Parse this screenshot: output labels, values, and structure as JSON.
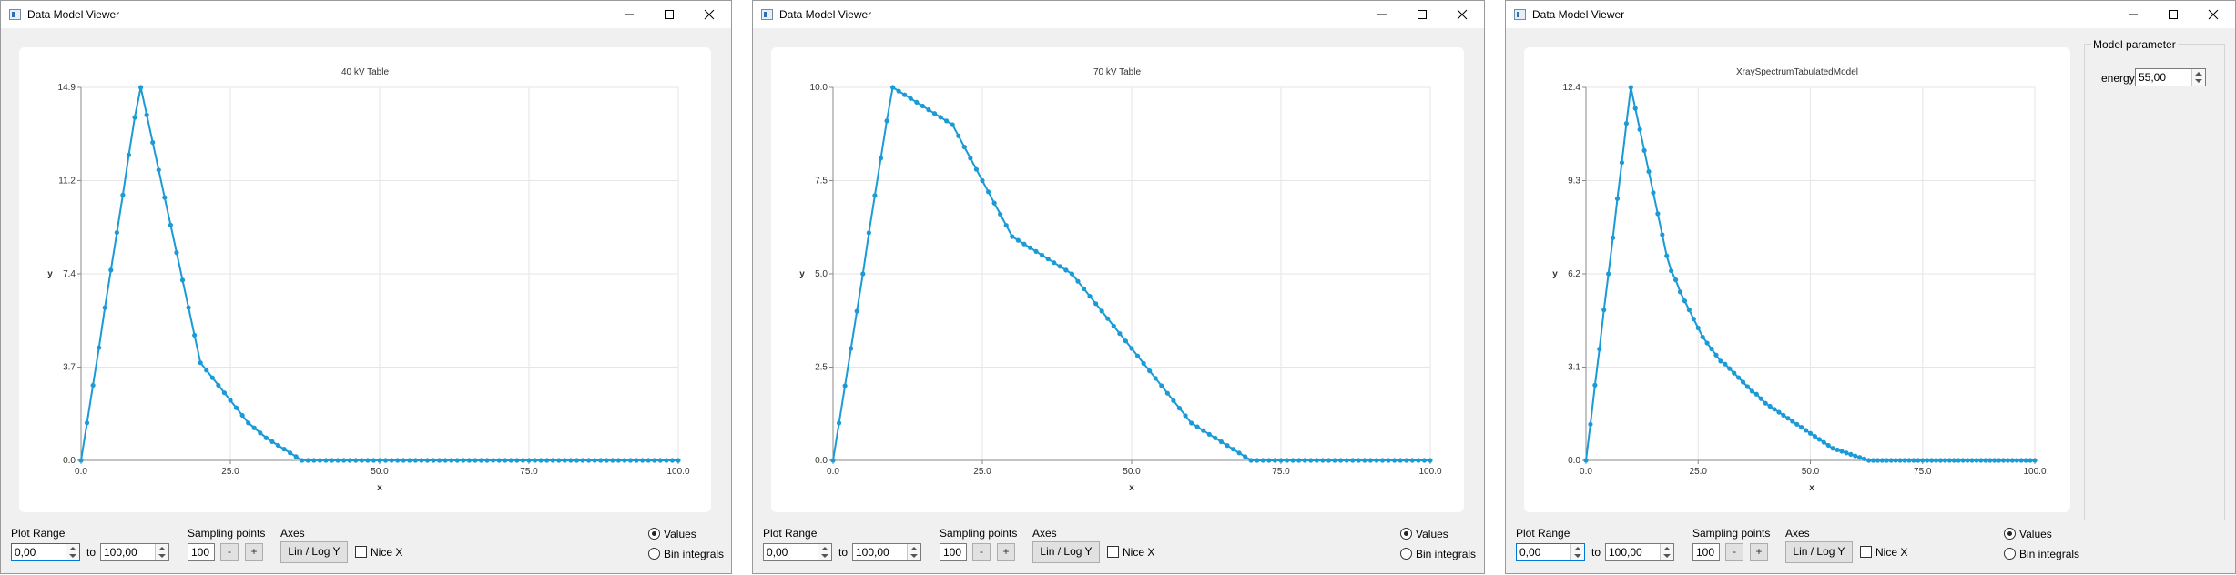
{
  "windows": [
    {
      "title": "Data Model Viewer",
      "chart": {
        "title": "40 kV Table",
        "xlabel": "x",
        "ylabel": "y",
        "yticks": [
          "0.0",
          "3.7",
          "7.4",
          "11.2",
          "14.9"
        ],
        "xticks": [
          "0.0",
          "25.0",
          "50.0",
          "75.0",
          "100.0"
        ]
      },
      "controls": {
        "plot_range_label": "Plot Range",
        "range_from": "0,00",
        "to_label": "to",
        "range_to": "100,00",
        "sampling_label": "Sampling points",
        "sampling_value": "100",
        "minus_label": "-",
        "plus_label": "+",
        "axes_label": "Axes",
        "linlog_label": "Lin / Log Y",
        "nicex_label": "Nice X",
        "values_label": "Values",
        "bin_label": "Bin integrals"
      }
    },
    {
      "title": "Data Model Viewer",
      "chart": {
        "title": "70 kV Table",
        "xlabel": "x",
        "ylabel": "y",
        "yticks": [
          "0.0",
          "2.5",
          "5.0",
          "7.5",
          "10.0"
        ],
        "xticks": [
          "0.0",
          "25.0",
          "50.0",
          "75.0",
          "100.0"
        ]
      },
      "controls": {
        "plot_range_label": "Plot Range",
        "range_from": "0,00",
        "to_label": "to",
        "range_to": "100,00",
        "sampling_label": "Sampling points",
        "sampling_value": "100",
        "minus_label": "-",
        "plus_label": "+",
        "axes_label": "Axes",
        "linlog_label": "Lin / Log Y",
        "nicex_label": "Nice X",
        "values_label": "Values",
        "bin_label": "Bin integrals"
      }
    },
    {
      "title": "Data Model Viewer",
      "chart": {
        "title": "XraySpectrumTabulatedModel",
        "xlabel": "x",
        "ylabel": "y",
        "yticks": [
          "0.0",
          "3.1",
          "6.2",
          "9.3",
          "12.4"
        ],
        "xticks": [
          "0.0",
          "25.0",
          "50.0",
          "75.0",
          "100.0"
        ]
      },
      "controls": {
        "plot_range_label": "Plot Range",
        "range_from": "0,00",
        "to_label": "to",
        "range_to": "100,00",
        "sampling_label": "Sampling points",
        "sampling_value": "100",
        "minus_label": "-",
        "plus_label": "+",
        "axes_label": "Axes",
        "linlog_label": "Lin / Log Y",
        "nicex_label": "Nice X",
        "values_label": "Values",
        "bin_label": "Bin integrals"
      },
      "model_parameter": {
        "group_title": "Model parameter",
        "energy_label": "energy",
        "energy_value": "55,00"
      }
    }
  ],
  "style": {
    "line_color": "#1a9ad6",
    "grid_color": "#e6e6e6"
  },
  "chart_data": [
    {
      "type": "line",
      "title": "40 kV Table",
      "xlabel": "x",
      "ylabel": "y",
      "xlim": [
        0,
        100
      ],
      "ylim": [
        0,
        14.9
      ],
      "series": [
        {
          "x": [
            0,
            1,
            2,
            3,
            4,
            5,
            6,
            7,
            8,
            9,
            10,
            11,
            12,
            13,
            14,
            15,
            16,
            17,
            18,
            19,
            20,
            21,
            22,
            23,
            24,
            25,
            26,
            27,
            28,
            29,
            30,
            31,
            32,
            33,
            34,
            35,
            36,
            37,
            38,
            39,
            40,
            41,
            42,
            43,
            44,
            45,
            46,
            47,
            48,
            49,
            50,
            51,
            52,
            53,
            54,
            55,
            56,
            57,
            58,
            59,
            60,
            61,
            62,
            63,
            64,
            65,
            66,
            67,
            68,
            69,
            70,
            71,
            72,
            73,
            74,
            75,
            76,
            77,
            78,
            79,
            80,
            81,
            82,
            83,
            84,
            85,
            86,
            87,
            88,
            89,
            90,
            91,
            92,
            93,
            94,
            95,
            96,
            97,
            98,
            99,
            100
          ],
          "y": [
            0.0,
            1.5,
            3.0,
            4.5,
            6.1,
            7.6,
            9.1,
            10.6,
            12.2,
            13.7,
            14.9,
            13.8,
            12.7,
            11.6,
            10.5,
            9.4,
            8.3,
            7.2,
            6.1,
            5.0,
            3.9,
            3.6,
            3.3,
            3.0,
            2.7,
            2.4,
            2.1,
            1.8,
            1.5,
            1.3,
            1.1,
            0.9,
            0.75,
            0.6,
            0.45,
            0.3,
            0.15,
            0.0,
            0.0,
            0.0,
            0.0,
            0.0,
            0.0,
            0.0,
            0.0,
            0.0,
            0.0,
            0.0,
            0.0,
            0.0,
            0.0,
            0.0,
            0.0,
            0.0,
            0.0,
            0.0,
            0.0,
            0.0,
            0.0,
            0.0,
            0.0,
            0.0,
            0.0,
            0.0,
            0.0,
            0.0,
            0.0,
            0.0,
            0.0,
            0.0,
            0.0,
            0.0,
            0.0,
            0.0,
            0.0,
            0.0,
            0.0,
            0.0,
            0.0,
            0.0,
            0.0,
            0.0,
            0.0,
            0.0,
            0.0,
            0.0,
            0.0,
            0.0,
            0.0,
            0.0,
            0.0,
            0.0,
            0.0,
            0.0,
            0.0,
            0.0,
            0.0,
            0.0,
            0.0,
            0.0,
            0.0
          ]
        }
      ]
    },
    {
      "type": "line",
      "title": "70 kV Table",
      "xlabel": "x",
      "ylabel": "y",
      "xlim": [
        0,
        100
      ],
      "ylim": [
        0,
        10.0
      ],
      "series": [
        {
          "x": [
            0,
            1,
            2,
            3,
            4,
            5,
            6,
            7,
            8,
            9,
            10,
            11,
            12,
            13,
            14,
            15,
            16,
            17,
            18,
            19,
            20,
            21,
            22,
            23,
            24,
            25,
            26,
            27,
            28,
            29,
            30,
            31,
            32,
            33,
            34,
            35,
            36,
            37,
            38,
            39,
            40,
            41,
            42,
            43,
            44,
            45,
            46,
            47,
            48,
            49,
            50,
            51,
            52,
            53,
            54,
            55,
            56,
            57,
            58,
            59,
            60,
            61,
            62,
            63,
            64,
            65,
            66,
            67,
            68,
            69,
            70,
            71,
            72,
            73,
            74,
            75,
            76,
            77,
            78,
            79,
            80,
            81,
            82,
            83,
            84,
            85,
            86,
            87,
            88,
            89,
            90,
            91,
            92,
            93,
            94,
            95,
            96,
            97,
            98,
            99,
            100
          ],
          "y": [
            0.0,
            1.0,
            2.0,
            3.0,
            4.0,
            5.0,
            6.1,
            7.1,
            8.1,
            9.1,
            10.0,
            9.9,
            9.8,
            9.7,
            9.6,
            9.5,
            9.4,
            9.3,
            9.2,
            9.1,
            9.0,
            8.7,
            8.4,
            8.1,
            7.8,
            7.5,
            7.2,
            6.9,
            6.6,
            6.3,
            6.0,
            5.9,
            5.8,
            5.7,
            5.6,
            5.5,
            5.4,
            5.3,
            5.2,
            5.1,
            5.0,
            4.8,
            4.6,
            4.4,
            4.2,
            4.0,
            3.8,
            3.6,
            3.4,
            3.2,
            3.0,
            2.8,
            2.6,
            2.4,
            2.2,
            2.0,
            1.8,
            1.6,
            1.4,
            1.2,
            1.0,
            0.9,
            0.8,
            0.7,
            0.6,
            0.5,
            0.4,
            0.3,
            0.2,
            0.1,
            0.0,
            0.0,
            0.0,
            0.0,
            0.0,
            0.0,
            0.0,
            0.0,
            0.0,
            0.0,
            0.0,
            0.0,
            0.0,
            0.0,
            0.0,
            0.0,
            0.0,
            0.0,
            0.0,
            0.0,
            0.0,
            0.0,
            0.0,
            0.0,
            0.0,
            0.0,
            0.0,
            0.0,
            0.0,
            0.0,
            0.0
          ]
        }
      ]
    },
    {
      "type": "line",
      "title": "XraySpectrumTabulatedModel",
      "xlabel": "x",
      "ylabel": "y",
      "xlim": [
        0,
        100
      ],
      "ylim": [
        0,
        12.4
      ],
      "series": [
        {
          "x": [
            0,
            1,
            2,
            3,
            4,
            5,
            6,
            7,
            8,
            9,
            10,
            11,
            12,
            13,
            14,
            15,
            16,
            17,
            18,
            19,
            20,
            21,
            22,
            23,
            24,
            25,
            26,
            27,
            28,
            29,
            30,
            31,
            32,
            33,
            34,
            35,
            36,
            37,
            38,
            39,
            40,
            41,
            42,
            43,
            44,
            45,
            46,
            47,
            48,
            49,
            50,
            51,
            52,
            53,
            54,
            55,
            56,
            57,
            58,
            59,
            60,
            61,
            62,
            63,
            64,
            65,
            66,
            67,
            68,
            69,
            70,
            71,
            72,
            73,
            74,
            75,
            76,
            77,
            78,
            79,
            80,
            81,
            82,
            83,
            84,
            85,
            86,
            87,
            88,
            89,
            90,
            91,
            92,
            93,
            94,
            95,
            96,
            97,
            98,
            99,
            100
          ],
          "y": [
            0.0,
            1.2,
            2.5,
            3.7,
            5.0,
            6.2,
            7.4,
            8.7,
            9.9,
            11.2,
            12.4,
            11.7,
            11.0,
            10.3,
            9.6,
            8.9,
            8.2,
            7.5,
            6.8,
            6.3,
            6.0,
            5.6,
            5.3,
            5.0,
            4.7,
            4.4,
            4.1,
            3.9,
            3.7,
            3.5,
            3.3,
            3.2,
            3.05,
            2.9,
            2.75,
            2.6,
            2.45,
            2.3,
            2.2,
            2.05,
            1.9,
            1.8,
            1.7,
            1.6,
            1.5,
            1.4,
            1.3,
            1.2,
            1.1,
            1.0,
            0.9,
            0.8,
            0.7,
            0.6,
            0.5,
            0.4,
            0.35,
            0.3,
            0.25,
            0.2,
            0.15,
            0.1,
            0.05,
            0.0,
            0.0,
            0.0,
            0.0,
            0.0,
            0.0,
            0.0,
            0.0,
            0.0,
            0.0,
            0.0,
            0.0,
            0.0,
            0.0,
            0.0,
            0.0,
            0.0,
            0.0,
            0.0,
            0.0,
            0.0,
            0.0,
            0.0,
            0.0,
            0.0,
            0.0,
            0.0,
            0.0,
            0.0,
            0.0,
            0.0,
            0.0,
            0.0,
            0.0,
            0.0,
            0.0,
            0.0,
            0.0
          ]
        }
      ]
    }
  ]
}
